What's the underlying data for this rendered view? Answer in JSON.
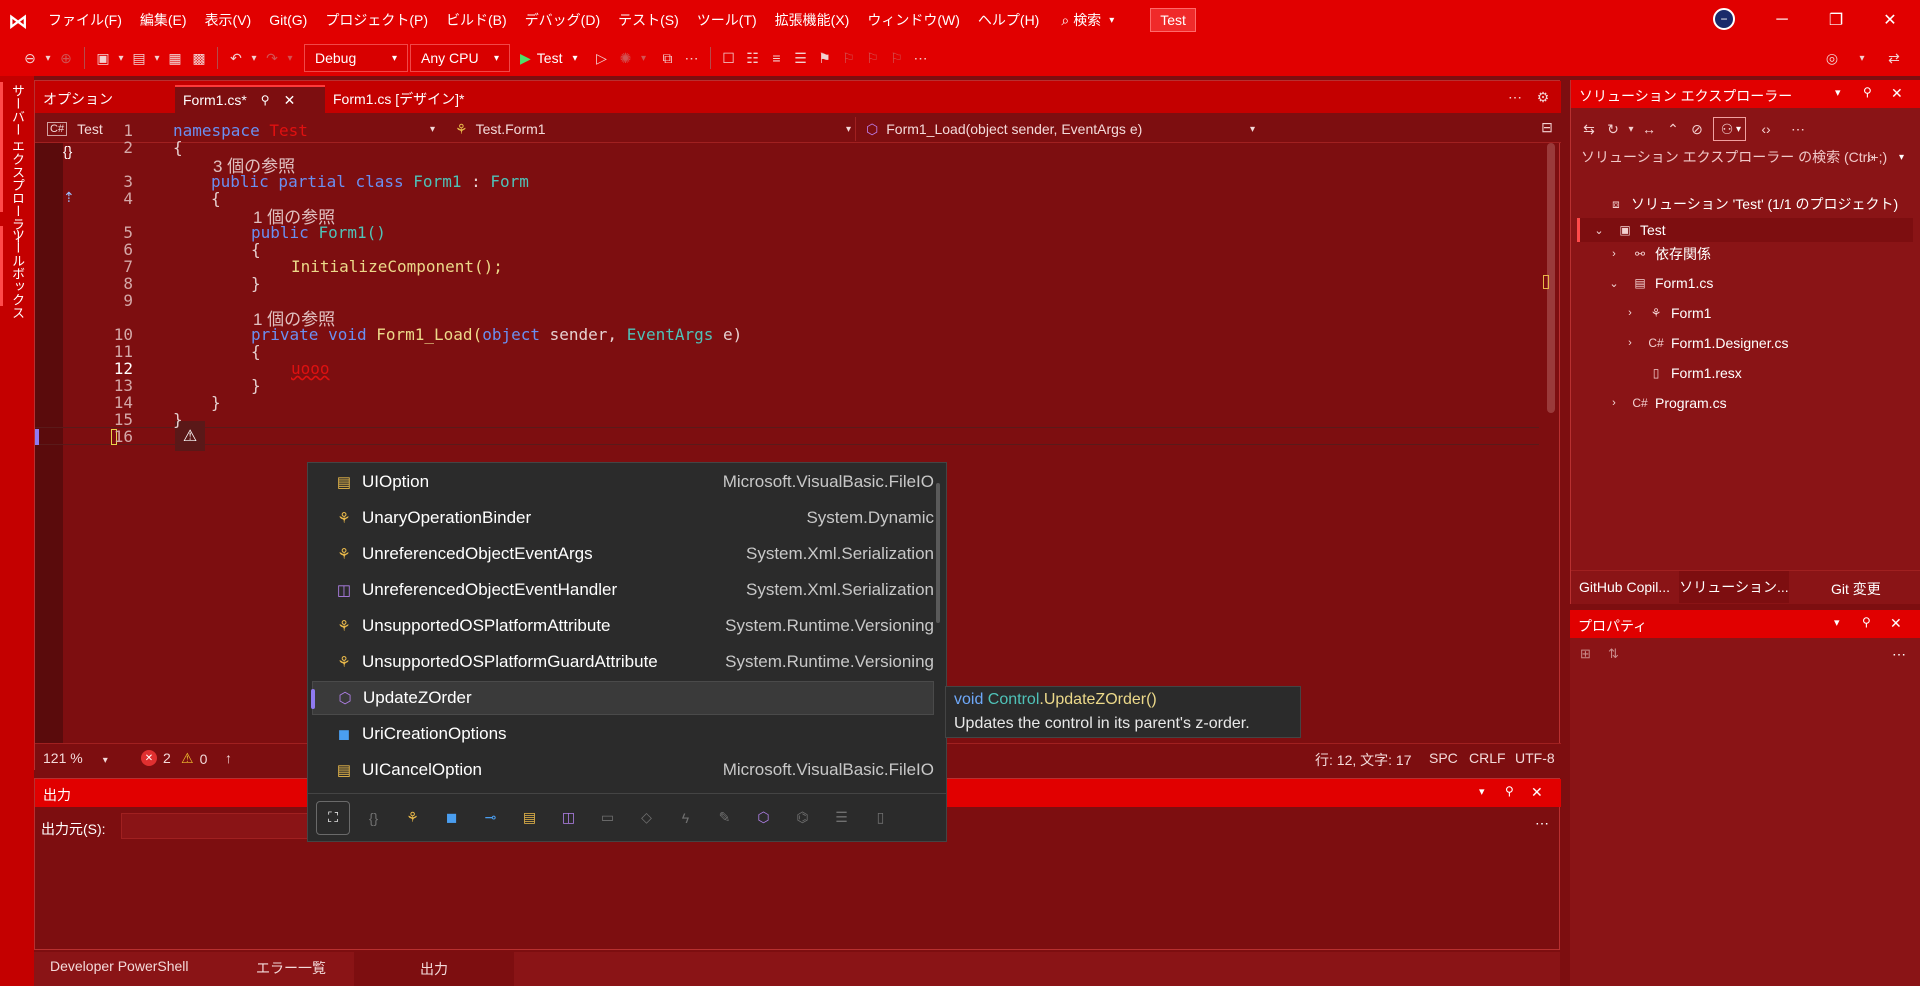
{
  "title_bar": {
    "menus": [
      "ファイル(F)",
      "編集(E)",
      "表示(V)",
      "Git(G)",
      "プロジェクト(P)",
      "ビルド(B)",
      "デバッグ(D)",
      "テスト(S)",
      "ツール(T)",
      "拡張機能(X)",
      "ウィンドウ(W)",
      "ヘルプ(H)"
    ],
    "search_label": "検索",
    "project_name": "Test"
  },
  "toolbar": {
    "configuration": "Debug",
    "platform": "Any CPU",
    "start_label": "Test"
  },
  "left_strip": {
    "server_explorer": "サーバー エクスプローラー",
    "toolbox": "ツールボックス"
  },
  "editor": {
    "tabs": [
      "オプション",
      "Form1.cs*",
      "Form1.cs [デザイン]*"
    ],
    "nav_project": "Test",
    "nav_class": "Test.Form1",
    "nav_member": "Form1_Load(object sender, EventArgs e)",
    "line_numbers": [
      "1",
      "2",
      "3",
      "4",
      "5",
      "6",
      "7",
      "8",
      "9",
      "10",
      "11",
      "12",
      "13",
      "14",
      "15",
      "16"
    ],
    "code": {
      "l1_kw": "namespace ",
      "l1_ns": "Test",
      "l2": "{",
      "ref1": "3 個の参照",
      "l3_kw": "public partial class ",
      "l3_name": "Form1",
      "l3_colon": " : ",
      "l3_base": "Form",
      "l4": "{",
      "ref2": "1 個の参照",
      "l5_kw": "public ",
      "l5_name": "Form1()",
      "l6": "{",
      "l7": "InitializeComponent();",
      "l8": "}",
      "ref3": "1 個の参照",
      "l10_kw": "private void ",
      "l10_name": "Form1_Load(",
      "l10_obj": "object",
      "l10_sender": " sender, ",
      "l10_ea": "EventArgs",
      "l10_e": " e)",
      "l11": "{",
      "l12": "uooo",
      "l13": "}",
      "l14": "}",
      "l15": "}"
    },
    "status": {
      "zoom": "121 %",
      "errors": "2",
      "warnings": "0",
      "position": "行: 12, 文字: 17",
      "whitespace": "SPC",
      "line_ending": "CRLF",
      "encoding": "UTF-8"
    }
  },
  "completion": {
    "items": [
      {
        "name": "UIOption",
        "namespace": "Microsoft.VisualBasic.FileIO",
        "icon": "enum-icon"
      },
      {
        "name": "UnaryOperationBinder",
        "namespace": "System.Dynamic",
        "icon": "class-icon"
      },
      {
        "name": "UnreferencedObjectEventArgs",
        "namespace": "System.Xml.Serialization",
        "icon": "class-icon"
      },
      {
        "name": "UnreferencedObjectEventHandler",
        "namespace": "System.Xml.Serialization",
        "icon": "delegate-icon"
      },
      {
        "name": "UnsupportedOSPlatformAttribute",
        "namespace": "System.Runtime.Versioning",
        "icon": "class-icon"
      },
      {
        "name": "UnsupportedOSPlatformGuardAttribute",
        "namespace": "System.Runtime.Versioning",
        "icon": "class-icon"
      },
      {
        "name": "UpdateZOrder",
        "namespace": "",
        "icon": "method-icon"
      },
      {
        "name": "UriCreationOptions",
        "namespace": "",
        "icon": "struct-icon"
      },
      {
        "name": "UICancelOption",
        "namespace": "Microsoft.VisualBasic.FileIO",
        "icon": "enum-icon"
      }
    ],
    "selected_index": 6,
    "tooltip_signature_prefix": "void ",
    "tooltip_signature_type": "Control",
    "tooltip_signature_member": ".UpdateZOrder()",
    "tooltip_description": "Updates the control in its parent's z-order."
  },
  "output": {
    "title": "出力",
    "source_label": "出力元(S):"
  },
  "bottom_tabs": [
    "Developer PowerShell",
    "エラー一覧",
    "出力"
  ],
  "solution_explorer": {
    "title": "ソリューション エクスプローラー",
    "search_placeholder": "ソリューション エクスプローラー の検索 (Ctrl+;)",
    "tree": [
      {
        "label": "ソリューション 'Test' (1/1 のプロジェクト)"
      },
      {
        "label": "Test"
      },
      {
        "label": "依存関係"
      },
      {
        "label": "Form1.cs"
      },
      {
        "label": "Form1"
      },
      {
        "label": "Form1.Designer.cs"
      },
      {
        "label": "Form1.resx"
      },
      {
        "label": "Program.cs"
      }
    ],
    "bottom_tabs": [
      "GitHub Copil...",
      "ソリューション...",
      "Git 変更"
    ]
  },
  "properties": {
    "title": "プロパティ"
  },
  "colors": {
    "chrome": "#e10000",
    "editor_bg": "#7d0e10",
    "popup_bg": "#2b2b2b",
    "accent": "#8f7af0"
  }
}
